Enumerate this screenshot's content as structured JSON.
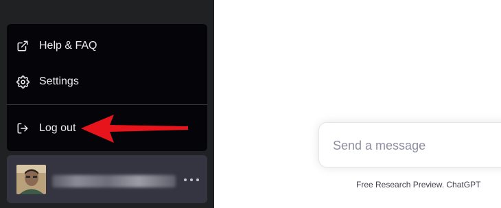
{
  "menu": {
    "items": [
      {
        "label": "Help & FAQ",
        "icon": "external-link-icon"
      },
      {
        "label": "Settings",
        "icon": "gear-icon"
      },
      {
        "label": "Log out",
        "icon": "logout-icon"
      }
    ]
  },
  "account": {
    "more_icon": "ellipsis-icon"
  },
  "composer": {
    "placeholder": "Send a message"
  },
  "footer": {
    "note": "Free Research Preview. ChatGPT"
  },
  "colors": {
    "sidebar_bg": "#202123",
    "menu_bg": "#050509",
    "account_bg": "#343541",
    "annotation_arrow": "#e8141b"
  }
}
